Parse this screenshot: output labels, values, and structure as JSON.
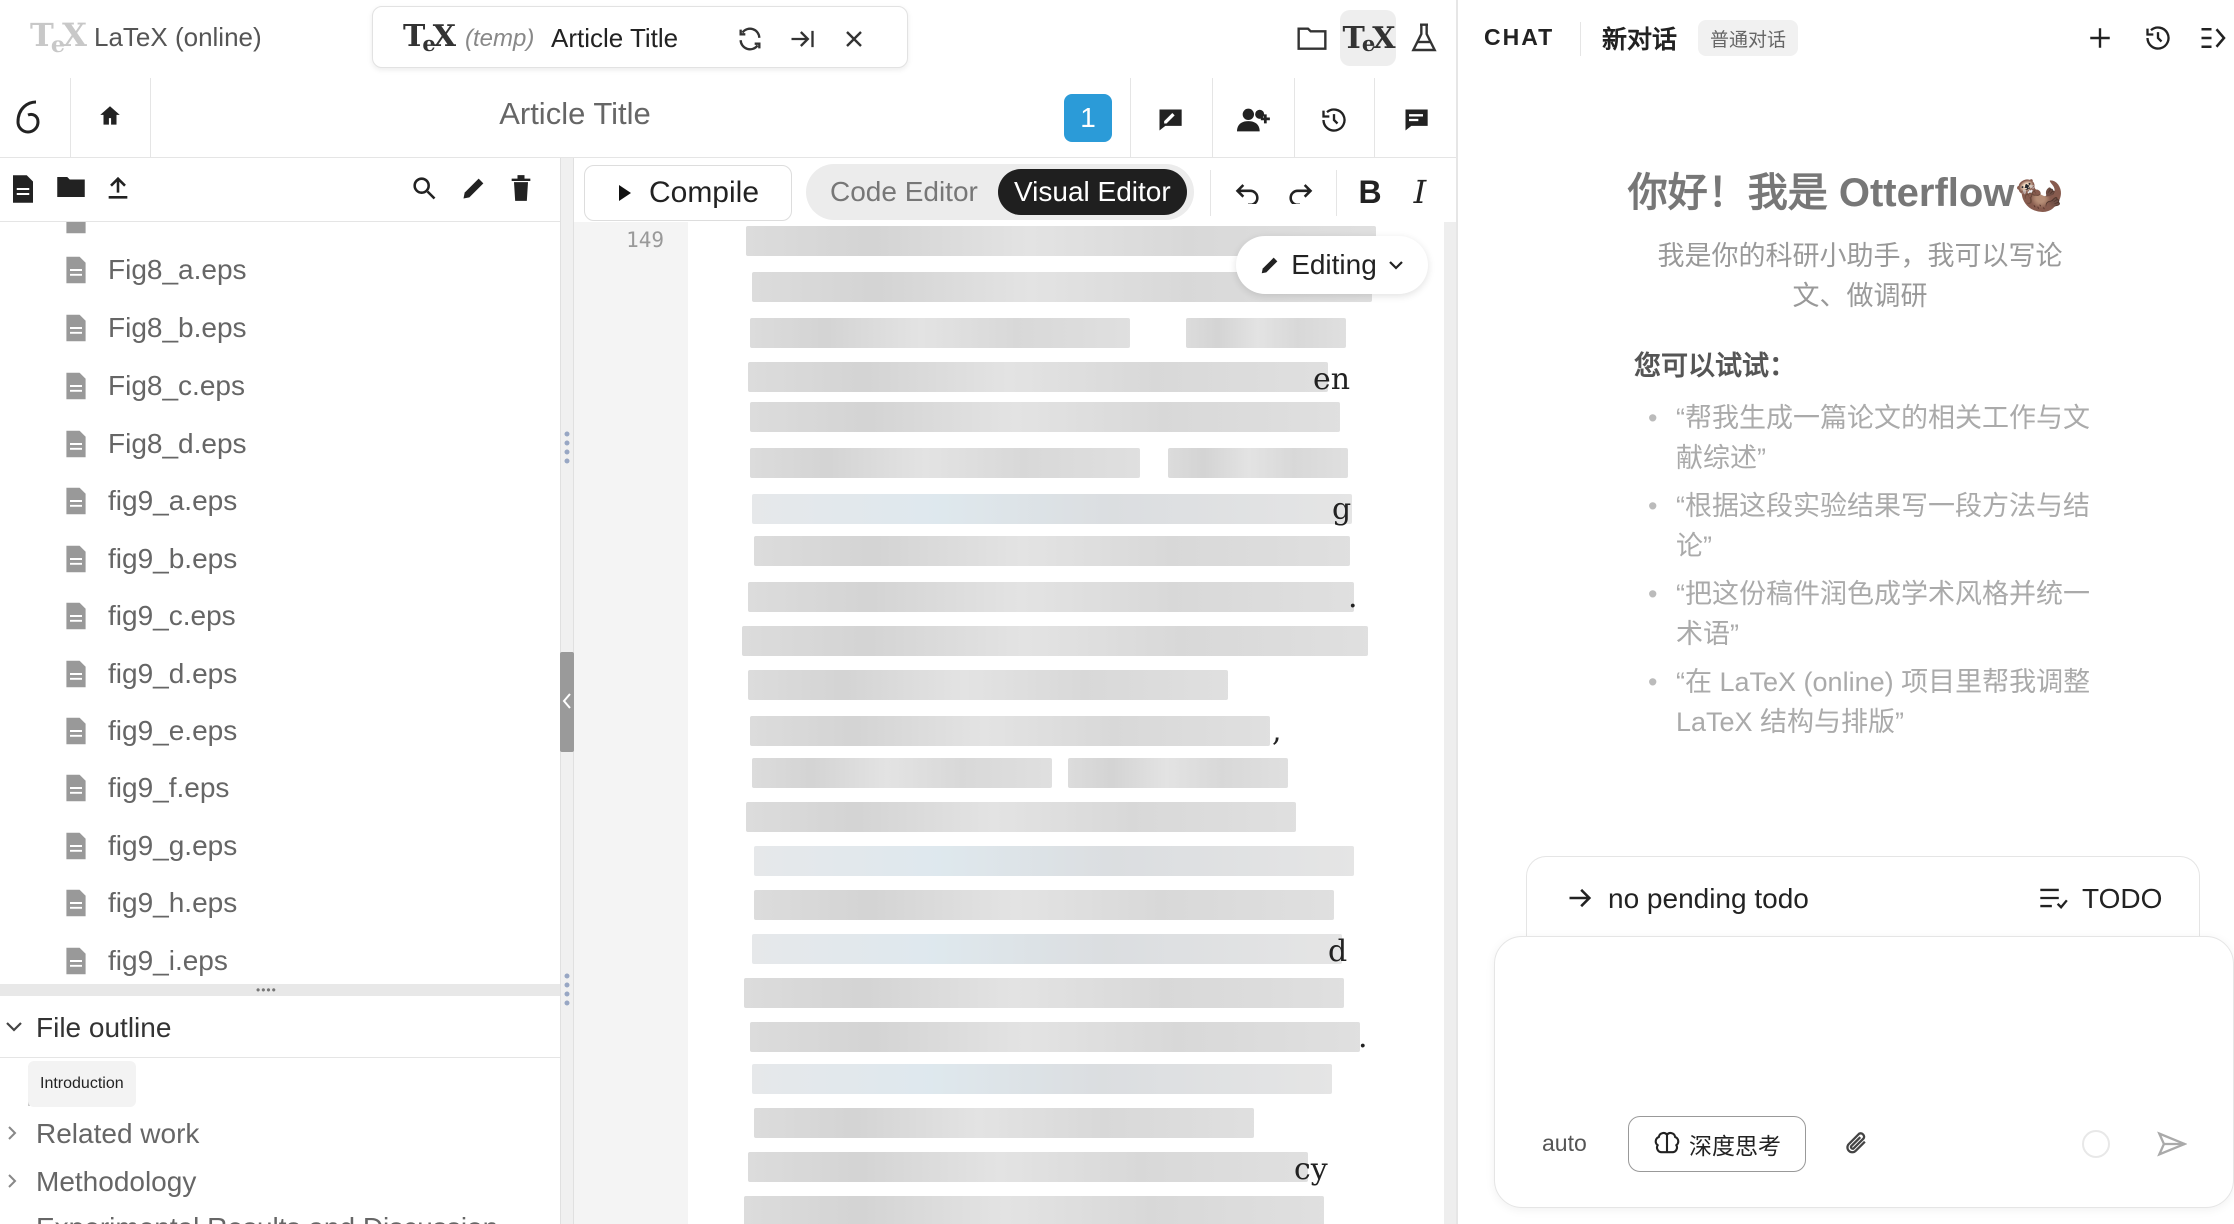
{
  "app": {
    "title": "LaTeX (online)"
  },
  "doc_pill": {
    "temp": "(temp)",
    "title": "Article Title"
  },
  "header": {
    "doc_title": "Article Title",
    "badge": "1"
  },
  "files": [
    "Fig8_a.eps",
    "Fig8_b.eps",
    "Fig8_c.eps",
    "Fig8_d.eps",
    "fig9_a.eps",
    "fig9_b.eps",
    "fig9_c.eps",
    "fig9_d.eps",
    "fig9_e.eps",
    "fig9_f.eps",
    "fig9_g.eps",
    "fig9_h.eps",
    "fig9_i.eps"
  ],
  "outline": {
    "header": "File outline",
    "items": [
      "Introduction",
      "Related work",
      "Methodology",
      "Experimental Results and Discussion"
    ]
  },
  "editor": {
    "compile_label": "Compile",
    "code_editor_label": "Code Editor",
    "visual_editor_label": "Visual Editor",
    "line_number": "149",
    "editing_label": "Editing",
    "edge_chars": [
      "en",
      "g",
      ".",
      ",",
      "d",
      ".",
      "cy"
    ]
  },
  "chat": {
    "label": "CHAT",
    "new_chat": "新对话",
    "normal_chat": "普通对话",
    "greeting": "你好！我是 Otterflow🦦",
    "intro": "我是你的科研小助手，我可以写论文、做调研",
    "try_label": "您可以试试：",
    "suggestions": [
      "“帮我生成一篇论文的相关工作与文献综述”",
      "“根据这段实验结果写一段方法与结论”",
      "“把这份稿件润色成学术风格并统一术语”",
      "“在 LaTeX (online) 项目里帮我调整 LaTeX 结构与排版”"
    ],
    "todo_text": "no pending todo",
    "todo_label": "TODO",
    "mode": "auto",
    "deep_think": "深度思考"
  },
  "colors": {
    "accent": "#2b9bd8",
    "visual_tab_bg": "#1f1f1f"
  }
}
